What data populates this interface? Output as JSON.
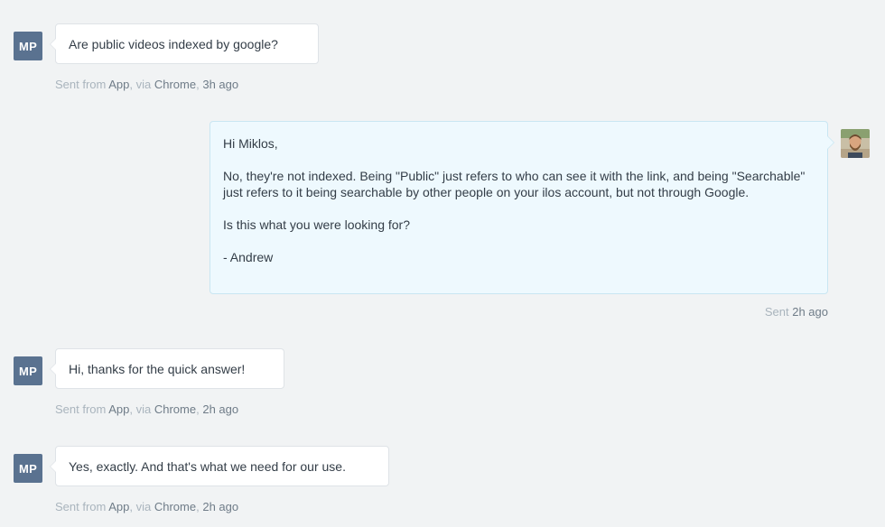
{
  "messages": [
    {
      "avatar_initials": "MP",
      "text": "Are public videos indexed by google?",
      "meta": {
        "sent_from": "Sent from ",
        "source": "App",
        "via": ", via ",
        "browser": "Chrome",
        "sep": ", ",
        "time": "3h ago"
      }
    },
    {
      "reply": {
        "greeting": "Hi Miklos,",
        "body": "No, they're not indexed. Being \"Public\" just refers to who can see it with the link, and being \"Searchable\" just refers to it being searchable by other people on your ilos account, but not through Google.",
        "question": "Is this what you were looking for?",
        "signature": "- Andrew"
      },
      "meta": {
        "sent": "Sent ",
        "time": "2h ago"
      }
    },
    {
      "avatar_initials": "MP",
      "text": "Hi, thanks for the quick answer!",
      "meta": {
        "sent_from": "Sent from ",
        "source": "App",
        "via": ", via ",
        "browser": "Chrome",
        "sep": ", ",
        "time": "2h ago"
      }
    },
    {
      "avatar_initials": "MP",
      "text": "Yes, exactly. And that's what we need for our use.",
      "meta": {
        "sent_from": "Sent from ",
        "source": "App",
        "via": ", via ",
        "browser": "Chrome",
        "sep": ", ",
        "time": "2h ago"
      }
    }
  ],
  "colors": {
    "background": "#f1f3f4",
    "avatar_bg": "#5a7290",
    "reply_bg": "#eef9fe",
    "reply_border": "#c9e6f2",
    "meta_muted": "#a9b4bd",
    "meta_highlight": "#6f7c88"
  },
  "icons": {
    "agent_avatar": "agent-avatar-photo"
  }
}
